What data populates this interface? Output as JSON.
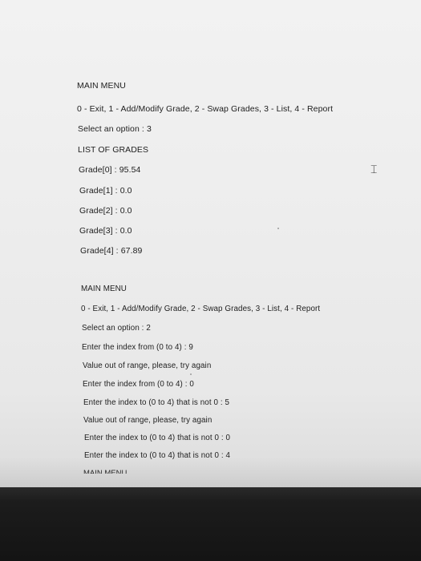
{
  "first_session": {
    "menu_title": "MAIN MENU",
    "menu_options": "0 - Exit, 1 - Add/Modify Grade, 2 - Swap Grades, 3 - List, 4 - Report",
    "prompt": "Select an option : 3",
    "list_title": "LIST OF GRADES",
    "grades": [
      "Grade[0] : 95.54",
      "Grade[1] : 0.0",
      "Grade[2] : 0.0",
      "Grade[3] : 0.0",
      "Grade[4] : 67.89"
    ]
  },
  "second_session": {
    "menu_title": "MAIN MENU",
    "menu_options": "0 - Exit, 1 - Add/Modify Grade, 2 - Swap Grades, 3 - List, 4 - Report",
    "prompt": "Select an option : 2",
    "lines": [
      "Enter the index from (0 to 4) : 9",
      "Value out of range, please, try again",
      "Enter the index from (0 to 4) : 0",
      "Enter the index to (0 to 4) that is not 0 : 5",
      "Value out of range, please, try again",
      "Enter the index to (0 to 4) that is not 0 : 0",
      "Enter the index to (0 to 4) that is not 0 : 4"
    ],
    "cutoff_text": "MAIN MENU"
  },
  "cursor_icon": "text-cursor-icon"
}
